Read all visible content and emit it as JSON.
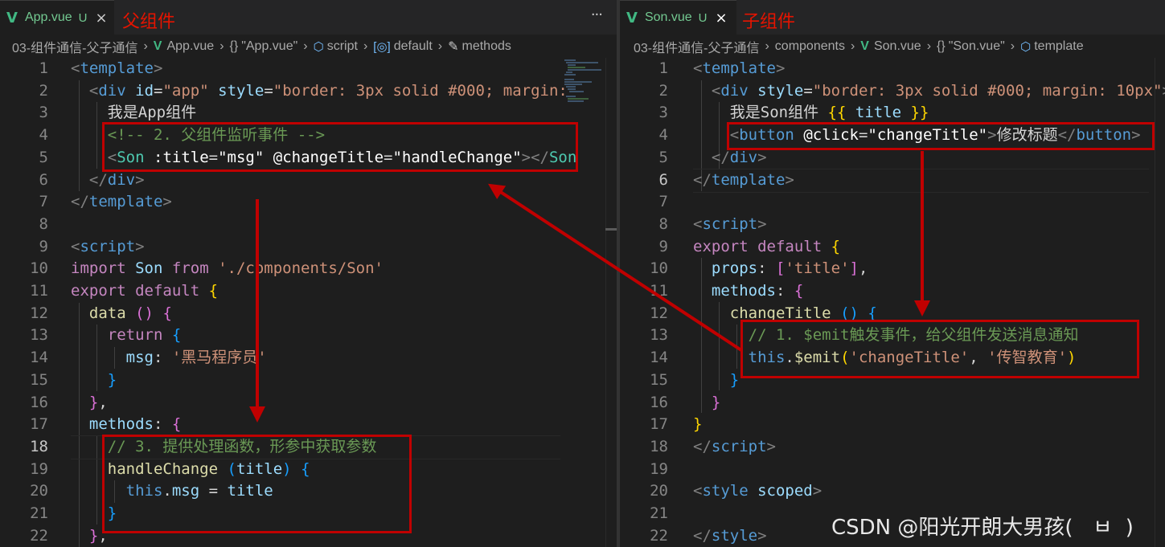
{
  "left": {
    "tab": {
      "icon": "vue-icon",
      "name": "App.vue",
      "status": "U",
      "note": "父组件"
    },
    "more": "···",
    "breadcrumb": [
      "03-组件通信-父子通信",
      "App.vue",
      "\"App.vue\"",
      "script",
      "default",
      "methods"
    ],
    "lines": [
      {
        "n": "1"
      },
      {
        "n": "2"
      },
      {
        "n": "3"
      },
      {
        "n": "4"
      },
      {
        "n": "5"
      },
      {
        "n": "6"
      },
      {
        "n": "7"
      },
      {
        "n": "8"
      },
      {
        "n": "9"
      },
      {
        "n": "10"
      },
      {
        "n": "11"
      },
      {
        "n": "12"
      },
      {
        "n": "13"
      },
      {
        "n": "14"
      },
      {
        "n": "15"
      },
      {
        "n": "16"
      },
      {
        "n": "17"
      },
      {
        "n": "18"
      },
      {
        "n": "19"
      },
      {
        "n": "20"
      },
      {
        "n": "21"
      },
      {
        "n": "22"
      }
    ],
    "code": {
      "l2_tag": "div",
      "l2_id": "id",
      "l2_idv": "\"app\"",
      "l2_style": "style",
      "l2_stylev": "\"border: 3px solid #000; margin:",
      "l3": "我是App组件",
      "l4": "<!-- 2. 父组件监听事件 -->",
      "l5_comp": "Son",
      "l5_a1": ":title",
      "l5_v1": "\"msg\"",
      "l5_a2": "@changeTitle",
      "l5_v2": "\"handleChange\"",
      "l5_end": "Son",
      "l6": "div",
      "l7": "template",
      "l1": "template",
      "l9": "script",
      "l10_import": "import",
      "l10_son": "Son",
      "l10_from": "from",
      "l10_path": "'./components/Son'",
      "l11_export": "export",
      "l11_default": "default",
      "l12_fn": "data",
      "l13_ret": "return",
      "l14_key": "msg",
      "l14_val": "'黑马程序员'",
      "l17_key": "methods",
      "l18": "// 3. 提供处理函数，形参中获取参数",
      "l19_fn": "handleChange",
      "l19_arg": "title",
      "l20_this": "this",
      "l20_prop": "msg",
      "l20_val": "title"
    }
  },
  "right": {
    "tab": {
      "icon": "vue-icon",
      "name": "Son.vue",
      "status": "U",
      "note": "子组件"
    },
    "breadcrumb": [
      "03-组件通信-父子通信",
      "components",
      "Son.vue",
      "\"Son.vue\"",
      "template"
    ],
    "lines": [
      {
        "n": "1"
      },
      {
        "n": "2"
      },
      {
        "n": "3"
      },
      {
        "n": "4"
      },
      {
        "n": "5"
      },
      {
        "n": "6"
      },
      {
        "n": "7"
      },
      {
        "n": "8"
      },
      {
        "n": "9"
      },
      {
        "n": "10"
      },
      {
        "n": "11"
      },
      {
        "n": "12"
      },
      {
        "n": "13"
      },
      {
        "n": "14"
      },
      {
        "n": "15"
      },
      {
        "n": "16"
      },
      {
        "n": "17"
      },
      {
        "n": "18"
      },
      {
        "n": "19"
      },
      {
        "n": "20"
      },
      {
        "n": "21"
      },
      {
        "n": "22"
      }
    ],
    "code": {
      "l1": "template",
      "l2_tag": "div",
      "l2_style": "style",
      "l2_stylev": "\"border: 3px solid #000; margin: 10px\"",
      "l3_txt": "我是Son组件 ",
      "l3_var": "title",
      "l4_tag": "button",
      "l4_attr": "@click",
      "l4_val": "\"changeTitle\"",
      "l4_txt": "修改标题",
      "l5": "div",
      "l6": "template",
      "l8": "script",
      "l9_export": "export",
      "l9_default": "default",
      "l10_key": "props",
      "l10_val": "'title'",
      "l11_key": "methods",
      "l12_fn": "changeTitle",
      "l13": "// 1. $emit触发事件，给父组件发送消息通知",
      "l14_this": "this",
      "l14_emit": "$emit",
      "l14_a1": "'changeTitle'",
      "l14_a2": "'传智教育'",
      "l18": "script",
      "l20_tag": "style",
      "l20_attr": "scoped",
      "l22": "style"
    }
  },
  "watermark": "CSDN @阳光开朗大男孩(   ㅂ  )",
  "colors": {
    "annotation": "#c00000",
    "vue": "#41b883",
    "background": "#1e1e1e"
  }
}
